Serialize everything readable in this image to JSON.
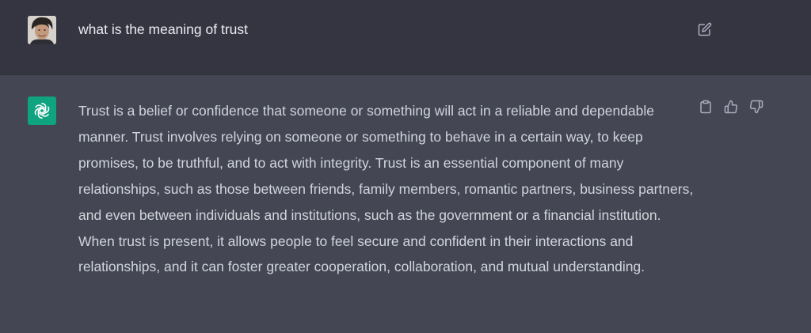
{
  "conversation": {
    "user_message": {
      "avatar_icon": "user-photo-avatar",
      "text": "what is the meaning of trust",
      "actions": {
        "edit_icon": "edit-icon"
      }
    },
    "assistant_message": {
      "avatar_icon": "openai-logo-icon",
      "avatar_color": "#10a37f",
      "text": "Trust is a belief or confidence that someone or something will act in a reliable and dependable manner. Trust involves relying on someone or something to behave in a certain way, to keep promises, to be truthful, and to act with integrity. Trust is an essential component of many relationships, such as those between friends, family members, romantic partners, business partners, and even between individuals and institutions, such as the government or a financial institution. When trust is present, it allows people to feel secure and confident in their interactions and relationships, and it can foster greater cooperation, collaboration, and mutual understanding.",
      "actions": {
        "copy_icon": "clipboard-icon",
        "thumbs_up_icon": "thumbs-up-icon",
        "thumbs_down_icon": "thumbs-down-icon"
      }
    }
  },
  "colors": {
    "user_row_bg": "#343541",
    "assistant_row_bg": "#444654",
    "text": "#d1d5db",
    "icon": "#acacbe"
  }
}
